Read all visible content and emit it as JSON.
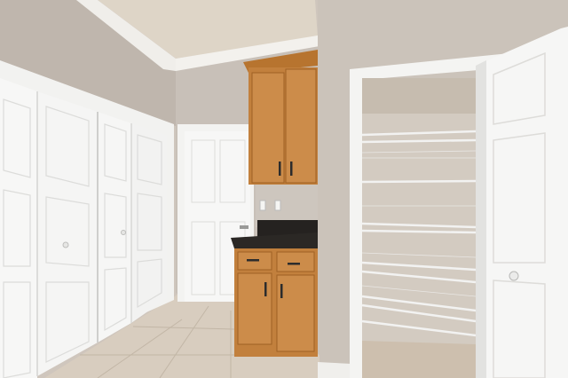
{
  "scene": {
    "description_free": true,
    "colors": {
      "wall": "#c9c1b9",
      "ceiling": "#ddd4c6",
      "door_white": "#f4f4f4",
      "cabinet_wood": "#c98a48",
      "countertop": "#2a2724",
      "floor_tile": "#d7cbbb"
    }
  }
}
